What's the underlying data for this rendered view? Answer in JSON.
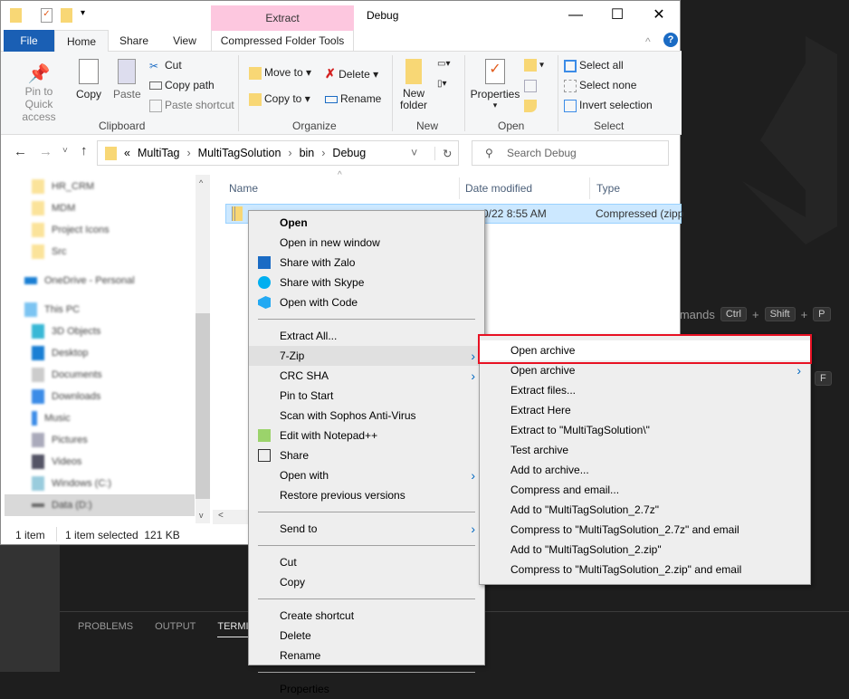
{
  "explorer": {
    "context_tab": "Extract",
    "title": "Debug",
    "tabs": [
      "File",
      "Home",
      "Share",
      "View",
      "Compressed Folder Tools"
    ],
    "ribbon": {
      "clipboard": {
        "label": "Clipboard",
        "pin": "Pin to Quick access",
        "copy": "Copy",
        "paste": "Paste",
        "cut": "Cut",
        "copy_path": "Copy path",
        "paste_shortcut": "Paste shortcut"
      },
      "organize": {
        "label": "Organize",
        "move_to": "Move to",
        "copy_to": "Copy to",
        "delete": "Delete",
        "rename": "Rename"
      },
      "new": {
        "label": "New",
        "new_folder": "New folder"
      },
      "open": {
        "label": "Open",
        "properties": "Properties"
      },
      "select": {
        "label": "Select",
        "select_all": "Select all",
        "select_none": "Select none",
        "invert": "Invert selection"
      }
    },
    "breadcrumb": [
      "MultiTag",
      "MultiTagSolution",
      "bin",
      "Debug"
    ],
    "breadcrumb_overflow": "«",
    "search_placeholder": "Search Debug",
    "nav_items": [
      "HR_CRM",
      "MDM",
      "Project Icons",
      "Src",
      "OneDrive - Personal",
      "This PC",
      "3D Objects",
      "Desktop",
      "Documents",
      "Downloads",
      "Music",
      "Pictures",
      "Videos",
      "Windows (C:)",
      "Data (D:)"
    ],
    "columns": [
      "Name",
      "Date modified",
      "Type"
    ],
    "file": {
      "date": "0/22 8:55 AM",
      "type": "Compressed (zipp"
    },
    "status": {
      "count": "1 item",
      "selected": "1 item selected  121 KB"
    }
  },
  "context_menu": {
    "items": [
      {
        "label": "Open",
        "bold": true
      },
      {
        "label": "Open in new window"
      },
      {
        "label": "Share with Zalo",
        "icon": "zalo-icon"
      },
      {
        "label": "Share with Skype",
        "icon": "skype-icon"
      },
      {
        "label": "Open with Code",
        "icon": "vscode-icon"
      },
      {
        "sep": true
      },
      {
        "label": "Extract All..."
      },
      {
        "label": "7-Zip",
        "submenu": true,
        "active": true
      },
      {
        "label": "CRC SHA",
        "submenu": true
      },
      {
        "label": "Pin to Start"
      },
      {
        "label": "Scan with Sophos Anti-Virus"
      },
      {
        "label": "Edit with Notepad++",
        "icon": "notepadpp-icon"
      },
      {
        "label": "Share",
        "icon": "share-icon"
      },
      {
        "label": "Open with",
        "submenu": true
      },
      {
        "label": "Restore previous versions"
      },
      {
        "sep": true
      },
      {
        "label": "Send to",
        "submenu": true
      },
      {
        "sep": true
      },
      {
        "label": "Cut"
      },
      {
        "label": "Copy"
      },
      {
        "sep": true
      },
      {
        "label": "Create shortcut"
      },
      {
        "label": "Delete"
      },
      {
        "label": "Rename"
      },
      {
        "sep": true
      },
      {
        "label": "Properties"
      }
    ]
  },
  "zip_submenu": {
    "items": [
      {
        "label": "Open archive",
        "highlighted": true
      },
      {
        "label": "Open archive",
        "submenu": true
      },
      {
        "label": "Extract files..."
      },
      {
        "label": "Extract Here"
      },
      {
        "label": "Extract to \"MultiTagSolution\\\""
      },
      {
        "label": "Test archive"
      },
      {
        "label": "Add to archive..."
      },
      {
        "label": "Compress and email..."
      },
      {
        "label": "Add to \"MultiTagSolution_2.7z\""
      },
      {
        "label": "Compress to \"MultiTagSolution_2.7z\" and email"
      },
      {
        "label": "Add to \"MultiTagSolution_2.zip\""
      },
      {
        "label": "Compress to \"MultiTagSolution_2.zip\" and email"
      }
    ]
  },
  "vscode": {
    "commands_hint": "mmands",
    "keys": [
      "Ctrl",
      "Shift",
      "P"
    ],
    "plus": "+",
    "key_f": "F",
    "panel_tabs": [
      "PROBLEMS",
      "OUTPUT",
      "TERMINA"
    ]
  },
  "colors": {
    "highlight_box": "#e81123",
    "file_tab": "#1a5fb4",
    "extract_tab": "#fdc7df",
    "selection": "#cce8ff"
  }
}
